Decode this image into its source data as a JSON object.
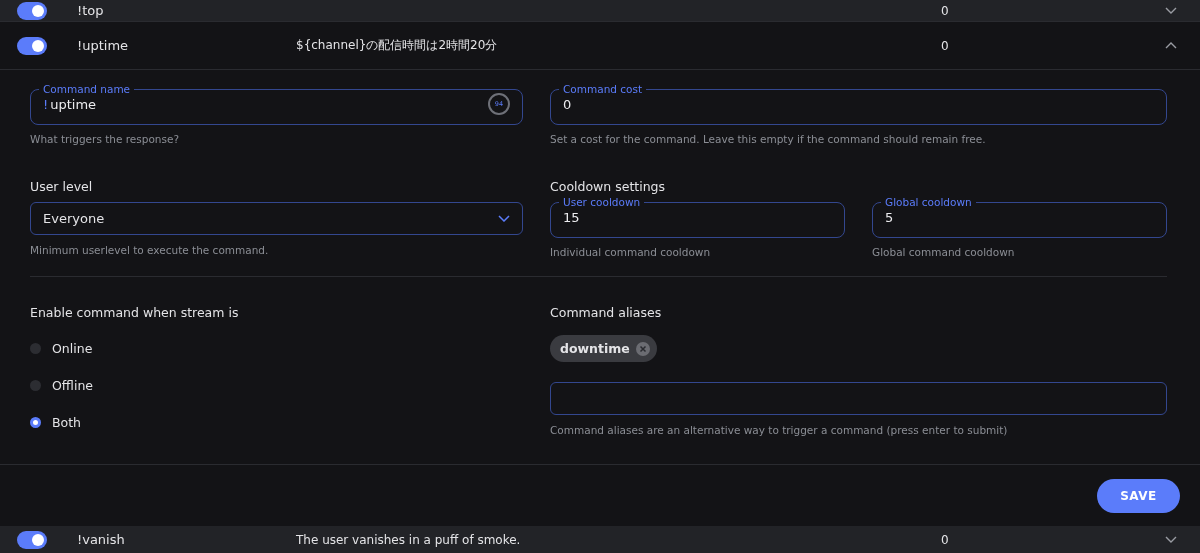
{
  "commands_before": [
    {
      "name": "!top",
      "count": "0",
      "enabled": true,
      "expanded": false
    }
  ],
  "current": {
    "name": "!uptime",
    "response": "${channel}の配信時間は2時間20分",
    "count": "0",
    "enabled": true,
    "expanded": true
  },
  "editor": {
    "command_name": {
      "label": "Command name",
      "prefix": "!",
      "value": "uptime",
      "remaining": "94",
      "help": "What triggers the response?"
    },
    "command_cost": {
      "label": "Command cost",
      "value": "0",
      "help": "Set a cost for the command. Leave this empty if the command should remain free."
    },
    "user_level": {
      "label": "User level",
      "value": "Everyone",
      "help": "Minimum userlevel to execute the command."
    },
    "cooldown": {
      "title": "Cooldown settings",
      "user": {
        "label": "User cooldown",
        "value": "15",
        "help": "Individual command cooldown"
      },
      "global": {
        "label": "Global cooldown",
        "value": "5",
        "help": "Global command cooldown"
      }
    },
    "stream_state": {
      "title": "Enable command when stream is",
      "options": [
        {
          "label": "Online",
          "selected": false
        },
        {
          "label": "Offline",
          "selected": false
        },
        {
          "label": "Both",
          "selected": true
        }
      ]
    },
    "aliases": {
      "title": "Command aliases",
      "chips": [
        "downtime"
      ],
      "help": "Command aliases are an alternative way to trigger a command (press enter to submit)"
    },
    "save_button": "SAVE"
  },
  "commands_after": [
    {
      "name": "!vanish",
      "response": "The user vanishes in a puff of smoke.",
      "count": "0",
      "enabled": true,
      "expanded": false
    }
  ]
}
